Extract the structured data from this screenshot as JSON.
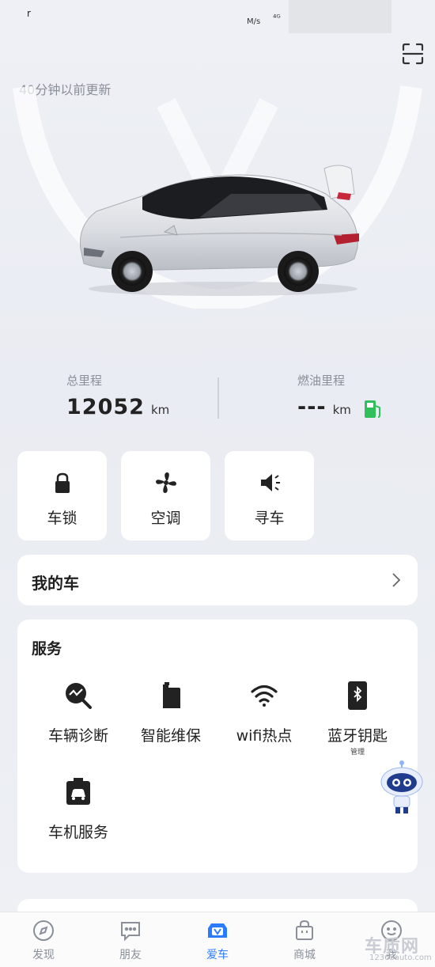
{
  "status_bar": {
    "left": "r",
    "speed": "M/s",
    "signal": "⁴ᴳ"
  },
  "header": {
    "update_text": "40分钟以前更新"
  },
  "stats": {
    "total": {
      "label": "总里程",
      "value": "12052",
      "unit": "km"
    },
    "fuel": {
      "label": "燃油里程",
      "value": "---",
      "unit": "km"
    }
  },
  "quick_actions": [
    {
      "label": "车锁",
      "icon": "lock-icon"
    },
    {
      "label": "空调",
      "icon": "fan-icon"
    },
    {
      "label": "寻车",
      "icon": "speaker-icon"
    }
  ],
  "my_car": {
    "title": "我的车"
  },
  "services": {
    "title": "服务",
    "items": [
      {
        "label": "车辆诊断",
        "icon": "diagnosis-icon"
      },
      {
        "label": "智能维保",
        "icon": "maintenance-icon"
      },
      {
        "label": "wifi热点",
        "icon": "wifi-icon"
      },
      {
        "label": "蓝牙钥匙",
        "sub": "管理",
        "icon": "bluetooth-icon"
      },
      {
        "label": "车机服务",
        "icon": "car-service-icon"
      }
    ]
  },
  "tabs": [
    {
      "label": "发现",
      "icon": "compass-icon"
    },
    {
      "label": "朋友",
      "icon": "chat-icon"
    },
    {
      "label": "爱车",
      "icon": "car-tab-icon",
      "active": true
    },
    {
      "label": "商城",
      "icon": "bag-icon"
    },
    {
      "label": "我",
      "icon": "smile-icon"
    }
  ],
  "watermark": {
    "main": "车质网",
    "sub": "12365auto.com"
  },
  "colors": {
    "accent": "#2b7bff",
    "fuel_green": "#2fbf5b",
    "text_gray": "#8a8f99"
  }
}
